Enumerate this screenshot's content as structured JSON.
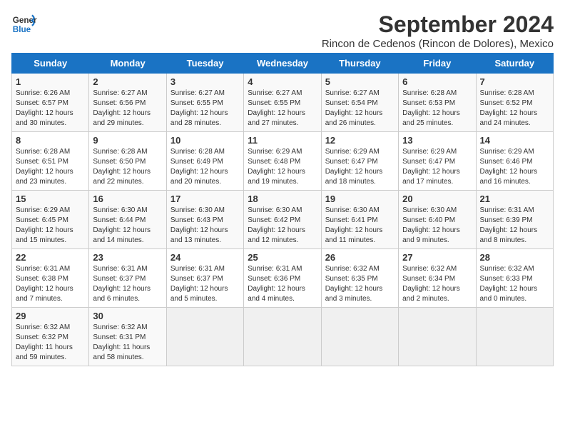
{
  "header": {
    "logo_line1": "General",
    "logo_line2": "Blue",
    "title": "September 2024",
    "subtitle": "Rincon de Cedenos (Rincon de Dolores), Mexico"
  },
  "days_of_week": [
    "Sunday",
    "Monday",
    "Tuesday",
    "Wednesday",
    "Thursday",
    "Friday",
    "Saturday"
  ],
  "weeks": [
    [
      {
        "day": "1",
        "sunrise": "Sunrise: 6:26 AM",
        "sunset": "Sunset: 6:57 PM",
        "daylight": "Daylight: 12 hours and 30 minutes."
      },
      {
        "day": "2",
        "sunrise": "Sunrise: 6:27 AM",
        "sunset": "Sunset: 6:56 PM",
        "daylight": "Daylight: 12 hours and 29 minutes."
      },
      {
        "day": "3",
        "sunrise": "Sunrise: 6:27 AM",
        "sunset": "Sunset: 6:55 PM",
        "daylight": "Daylight: 12 hours and 28 minutes."
      },
      {
        "day": "4",
        "sunrise": "Sunrise: 6:27 AM",
        "sunset": "Sunset: 6:55 PM",
        "daylight": "Daylight: 12 hours and 27 minutes."
      },
      {
        "day": "5",
        "sunrise": "Sunrise: 6:27 AM",
        "sunset": "Sunset: 6:54 PM",
        "daylight": "Daylight: 12 hours and 26 minutes."
      },
      {
        "day": "6",
        "sunrise": "Sunrise: 6:28 AM",
        "sunset": "Sunset: 6:53 PM",
        "daylight": "Daylight: 12 hours and 25 minutes."
      },
      {
        "day": "7",
        "sunrise": "Sunrise: 6:28 AM",
        "sunset": "Sunset: 6:52 PM",
        "daylight": "Daylight: 12 hours and 24 minutes."
      }
    ],
    [
      {
        "day": "8",
        "sunrise": "Sunrise: 6:28 AM",
        "sunset": "Sunset: 6:51 PM",
        "daylight": "Daylight: 12 hours and 23 minutes."
      },
      {
        "day": "9",
        "sunrise": "Sunrise: 6:28 AM",
        "sunset": "Sunset: 6:50 PM",
        "daylight": "Daylight: 12 hours and 22 minutes."
      },
      {
        "day": "10",
        "sunrise": "Sunrise: 6:28 AM",
        "sunset": "Sunset: 6:49 PM",
        "daylight": "Daylight: 12 hours and 20 minutes."
      },
      {
        "day": "11",
        "sunrise": "Sunrise: 6:29 AM",
        "sunset": "Sunset: 6:48 PM",
        "daylight": "Daylight: 12 hours and 19 minutes."
      },
      {
        "day": "12",
        "sunrise": "Sunrise: 6:29 AM",
        "sunset": "Sunset: 6:47 PM",
        "daylight": "Daylight: 12 hours and 18 minutes."
      },
      {
        "day": "13",
        "sunrise": "Sunrise: 6:29 AM",
        "sunset": "Sunset: 6:47 PM",
        "daylight": "Daylight: 12 hours and 17 minutes."
      },
      {
        "day": "14",
        "sunrise": "Sunrise: 6:29 AM",
        "sunset": "Sunset: 6:46 PM",
        "daylight": "Daylight: 12 hours and 16 minutes."
      }
    ],
    [
      {
        "day": "15",
        "sunrise": "Sunrise: 6:29 AM",
        "sunset": "Sunset: 6:45 PM",
        "daylight": "Daylight: 12 hours and 15 minutes."
      },
      {
        "day": "16",
        "sunrise": "Sunrise: 6:30 AM",
        "sunset": "Sunset: 6:44 PM",
        "daylight": "Daylight: 12 hours and 14 minutes."
      },
      {
        "day": "17",
        "sunrise": "Sunrise: 6:30 AM",
        "sunset": "Sunset: 6:43 PM",
        "daylight": "Daylight: 12 hours and 13 minutes."
      },
      {
        "day": "18",
        "sunrise": "Sunrise: 6:30 AM",
        "sunset": "Sunset: 6:42 PM",
        "daylight": "Daylight: 12 hours and 12 minutes."
      },
      {
        "day": "19",
        "sunrise": "Sunrise: 6:30 AM",
        "sunset": "Sunset: 6:41 PM",
        "daylight": "Daylight: 12 hours and 11 minutes."
      },
      {
        "day": "20",
        "sunrise": "Sunrise: 6:30 AM",
        "sunset": "Sunset: 6:40 PM",
        "daylight": "Daylight: 12 hours and 9 minutes."
      },
      {
        "day": "21",
        "sunrise": "Sunrise: 6:31 AM",
        "sunset": "Sunset: 6:39 PM",
        "daylight": "Daylight: 12 hours and 8 minutes."
      }
    ],
    [
      {
        "day": "22",
        "sunrise": "Sunrise: 6:31 AM",
        "sunset": "Sunset: 6:38 PM",
        "daylight": "Daylight: 12 hours and 7 minutes."
      },
      {
        "day": "23",
        "sunrise": "Sunrise: 6:31 AM",
        "sunset": "Sunset: 6:37 PM",
        "daylight": "Daylight: 12 hours and 6 minutes."
      },
      {
        "day": "24",
        "sunrise": "Sunrise: 6:31 AM",
        "sunset": "Sunset: 6:37 PM",
        "daylight": "Daylight: 12 hours and 5 minutes."
      },
      {
        "day": "25",
        "sunrise": "Sunrise: 6:31 AM",
        "sunset": "Sunset: 6:36 PM",
        "daylight": "Daylight: 12 hours and 4 minutes."
      },
      {
        "day": "26",
        "sunrise": "Sunrise: 6:32 AM",
        "sunset": "Sunset: 6:35 PM",
        "daylight": "Daylight: 12 hours and 3 minutes."
      },
      {
        "day": "27",
        "sunrise": "Sunrise: 6:32 AM",
        "sunset": "Sunset: 6:34 PM",
        "daylight": "Daylight: 12 hours and 2 minutes."
      },
      {
        "day": "28",
        "sunrise": "Sunrise: 6:32 AM",
        "sunset": "Sunset: 6:33 PM",
        "daylight": "Daylight: 12 hours and 0 minutes."
      }
    ],
    [
      {
        "day": "29",
        "sunrise": "Sunrise: 6:32 AM",
        "sunset": "Sunset: 6:32 PM",
        "daylight": "Daylight: 11 hours and 59 minutes."
      },
      {
        "day": "30",
        "sunrise": "Sunrise: 6:32 AM",
        "sunset": "Sunset: 6:31 PM",
        "daylight": "Daylight: 11 hours and 58 minutes."
      },
      null,
      null,
      null,
      null,
      null
    ]
  ]
}
